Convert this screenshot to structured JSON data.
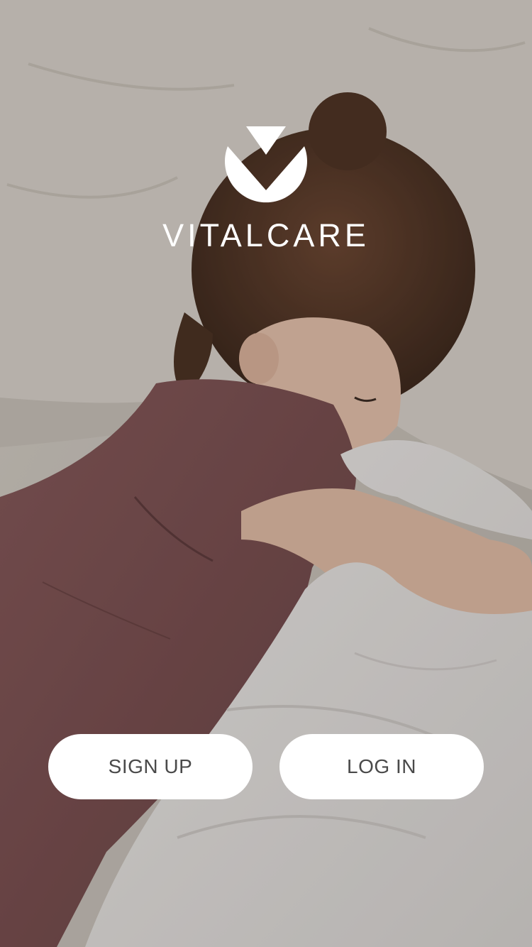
{
  "brand": {
    "name": "VITALCARE",
    "logo_icon": "vitalcare-v-logo-icon"
  },
  "background": {
    "description_icon": "sleeping-child-photo",
    "colors": {
      "sheet": "#cfcac3",
      "pillow": "#dcd7cf",
      "dress": "#7a4f4f",
      "hair": "#4a3122",
      "skin": "#e6c3ad",
      "blanket": "#e7e4e2"
    }
  },
  "actions": {
    "signup_label": "SIGN UP",
    "login_label": "LOG IN"
  },
  "colors": {
    "button_bg": "#ffffff",
    "button_text": "#4a4a4a",
    "brand_text": "#ffffff"
  }
}
